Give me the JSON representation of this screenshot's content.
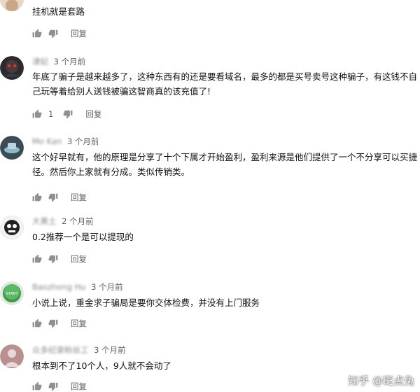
{
  "comments": [
    {
      "author": "",
      "time": "",
      "text": "挂机就是套路",
      "likes": "",
      "reply_label": "回复",
      "avatar_icon": "avatar-icon"
    },
    {
      "author": "津妃",
      "time": "3 个月前",
      "text": "年底了骗子是越来越多了，这种东西有的还是要看域名，最多的都是买号卖号这种骗子，有这钱不自己玩等着给别人送钱被骗这智商真的该充值了!",
      "likes": "1",
      "reply_label": "回复",
      "avatar_icon": "avatar-icon"
    },
    {
      "author": "Mo Kan",
      "time": "3 个月前",
      "text": "这个好早就有，他的原理是分享了十个下属才开始盈利，盈利来源是他们提供了一个不分享可以买捷径。然后你上家就有分成。类似传销类。",
      "likes": "",
      "reply_label": "回复",
      "avatar_icon": "avatar-icon"
    },
    {
      "author": "大黄土",
      "time": "2 个月前",
      "text": "0.2推荐一个是可以提现的",
      "likes": "",
      "reply_label": "回复",
      "avatar_icon": "avatar-icon"
    },
    {
      "author": "Baozhong Hu",
      "time": "3 个月前",
      "text": "小说上说，重金求子骗局是要你交体检费，并没有上门服务",
      "likes": "",
      "reply_label": "回复",
      "avatar_icon": "start-button-avatar-icon",
      "avatar_text": "START"
    },
    {
      "author": "众多纪录粉丝工",
      "time": "3 个月前",
      "text": "根本到不了10个人，9人就不会动了",
      "likes": "",
      "reply_label": "回复",
      "avatar_icon": "avatar-icon"
    }
  ],
  "watermark": "知乎 @斑点兔",
  "colors": {
    "meta": "#606060",
    "text": "#111111",
    "icon": "#909090"
  }
}
